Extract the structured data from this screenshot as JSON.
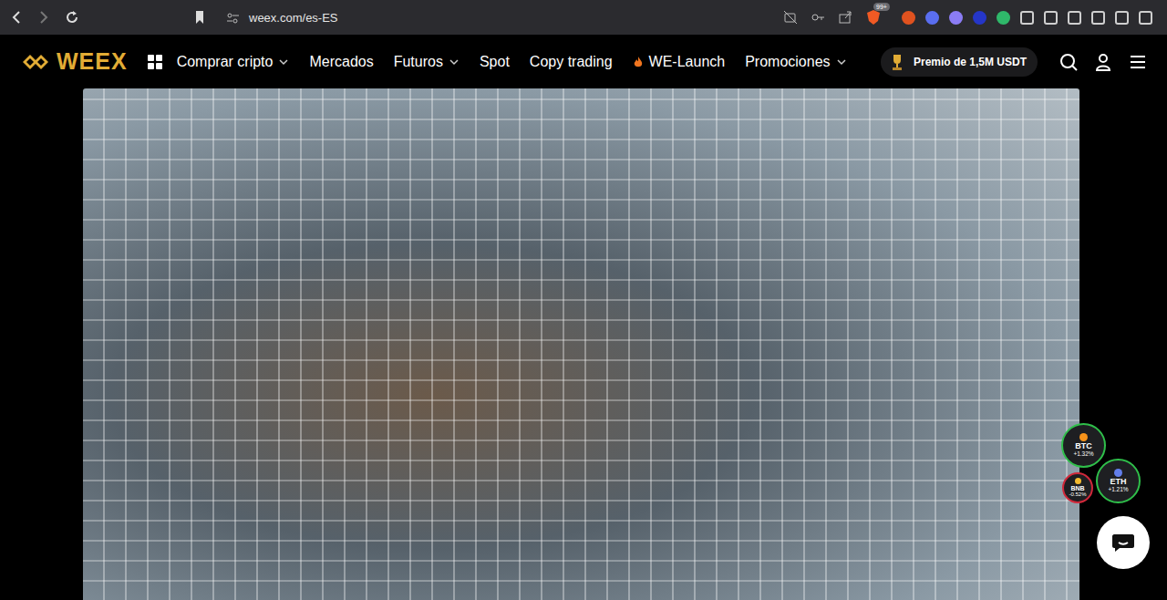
{
  "browser": {
    "url": "weex.com/es-ES",
    "shield_badge": "99+"
  },
  "nav": {
    "logo": "WEEX",
    "items": [
      {
        "label": "Comprar cripto",
        "dropdown": true,
        "hot": false
      },
      {
        "label": "Mercados",
        "dropdown": false,
        "hot": false
      },
      {
        "label": "Futuros",
        "dropdown": true,
        "hot": false
      },
      {
        "label": "Spot",
        "dropdown": false,
        "hot": false
      },
      {
        "label": "Copy trading",
        "dropdown": false,
        "hot": false
      },
      {
        "label": "WE-Launch",
        "dropdown": false,
        "hot": true
      },
      {
        "label": "Promociones",
        "dropdown": true,
        "hot": false
      }
    ],
    "prize": "Premio de 1,5M USDT"
  },
  "coins": [
    {
      "symbol": "BTC",
      "change": "+1.32%",
      "color": "#2fbf4a"
    },
    {
      "symbol": "BNB",
      "change": "-0.52%",
      "color": "#d0283a"
    },
    {
      "symbol": "ETH",
      "change": "+1.21%",
      "color": "#2fbf4a"
    }
  ]
}
